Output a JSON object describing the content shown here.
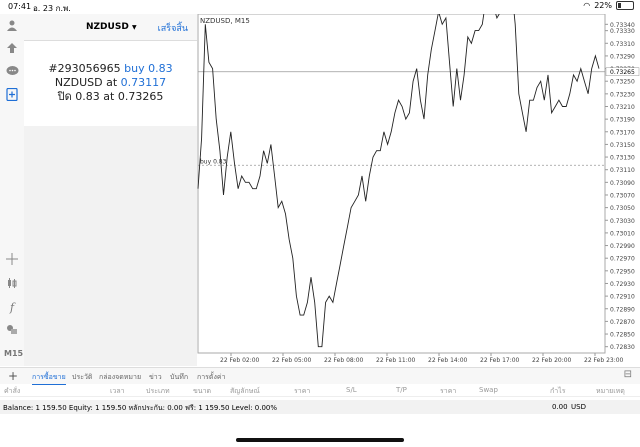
{
  "status_bar": {
    "time": "07:41",
    "date": "อ. 23 ก.พ.",
    "battery": "22%"
  },
  "left_toolbar": {
    "timeframe": "M15"
  },
  "order_panel": {
    "symbol": "NZDUSD",
    "done_label": "เสร็จสิ้น",
    "order_number": "#293056965",
    "order_action": "buy 0.83",
    "order_symbol_line": "NZDUSD at",
    "order_open_price": "0.73117",
    "close_line": "ปิด 0.83 at 0.73265"
  },
  "chart": {
    "header": "NZDUSD, M15",
    "current_price": "0.73265",
    "order_line_label": "buy 0.83",
    "chart_data": {
      "type": "line",
      "title": "NZDUSD, M15",
      "ylim": [
        0.7282,
        0.7335
      ],
      "y_ticks": [
        "0.73340",
        "0.73330",
        "0.73310",
        "0.73290",
        "0.73270",
        "0.73250",
        "0.73230",
        "0.73210",
        "0.73190",
        "0.73170",
        "0.73150",
        "0.73130",
        "0.73110",
        "0.73090",
        "0.73070",
        "0.73050",
        "0.73030",
        "0.73010",
        "0.72990",
        "0.72970",
        "0.72950",
        "0.72930",
        "0.72910",
        "0.72890",
        "0.72870",
        "0.72850",
        "0.72830"
      ],
      "x_ticks": [
        "22 Feb 02:00",
        "22 Feb 05:00",
        "22 Feb 08:00",
        "22 Feb 11:00",
        "22 Feb 14:00",
        "22 Feb 17:00",
        "22 Feb 20:00",
        "22 Feb 23:00"
      ],
      "levels": {
        "current": 0.73265,
        "order": 0.73117
      },
      "values": [
        0.7308,
        0.7316,
        0.7334,
        0.7328,
        0.7327,
        0.7319,
        0.7314,
        0.7307,
        0.7313,
        0.7317,
        0.7312,
        0.7308,
        0.731,
        0.7309,
        0.7309,
        0.7308,
        0.7308,
        0.731,
        0.7314,
        0.7312,
        0.7315,
        0.731,
        0.7305,
        0.7306,
        0.7304,
        0.73,
        0.7297,
        0.7291,
        0.7288,
        0.7288,
        0.729,
        0.7294,
        0.729,
        0.7283,
        0.7283,
        0.729,
        0.7291,
        0.729,
        0.7293,
        0.7296,
        0.7299,
        0.7302,
        0.7305,
        0.7306,
        0.7307,
        0.731,
        0.7306,
        0.731,
        0.7313,
        0.7314,
        0.7314,
        0.7317,
        0.7315,
        0.7317,
        0.732,
        0.7322,
        0.7321,
        0.7319,
        0.732,
        0.7325,
        0.7327,
        0.7322,
        0.7319,
        0.7326,
        0.733,
        0.7333,
        0.7336,
        0.7334,
        0.7335,
        0.7328,
        0.7321,
        0.7327,
        0.7322,
        0.7326,
        0.7332,
        0.7331,
        0.7333,
        0.7333,
        0.7334,
        0.7338,
        0.7343,
        0.7337,
        0.7335,
        0.7336,
        0.7338,
        0.7342,
        0.734,
        0.7334,
        0.7323,
        0.732,
        0.7317,
        0.7322,
        0.7322,
        0.7324,
        0.7325,
        0.7322,
        0.7326,
        0.732,
        0.7321,
        0.7322,
        0.7321,
        0.7321,
        0.7323,
        0.7326,
        0.7325,
        0.7327,
        0.7325,
        0.7323,
        0.7327,
        0.7329,
        0.7327
      ]
    }
  },
  "tabs": [
    {
      "label": "การซื้อขาย",
      "active": true
    },
    {
      "label": "ประวัติ"
    },
    {
      "label": "กล่องจดหมาย"
    },
    {
      "label": "ข่าว"
    },
    {
      "label": "บันทึก"
    },
    {
      "label": "การตั้งค่า"
    }
  ],
  "columns": [
    "คำสั่ง",
    "เวลา",
    "ประเภท",
    "ขนาด",
    "สัญลักษณ์",
    "ราคา",
    "S/L",
    "T/P",
    "ราคา",
    "Swap",
    "กำไร",
    "หมายเหตุ"
  ],
  "balance": {
    "text": "Balance: 1 159.50 Equity: 1 159.50 หลักประกัน: 0.00 ฟรี: 1 159.50 Level: 0.00%",
    "profit": "0.00",
    "currency": "USD"
  },
  "icons": {
    "crosshair": "crosshair-icon",
    "indicators": "candlestick-icon",
    "function": "function-icon",
    "objects": "shapes-icon"
  }
}
